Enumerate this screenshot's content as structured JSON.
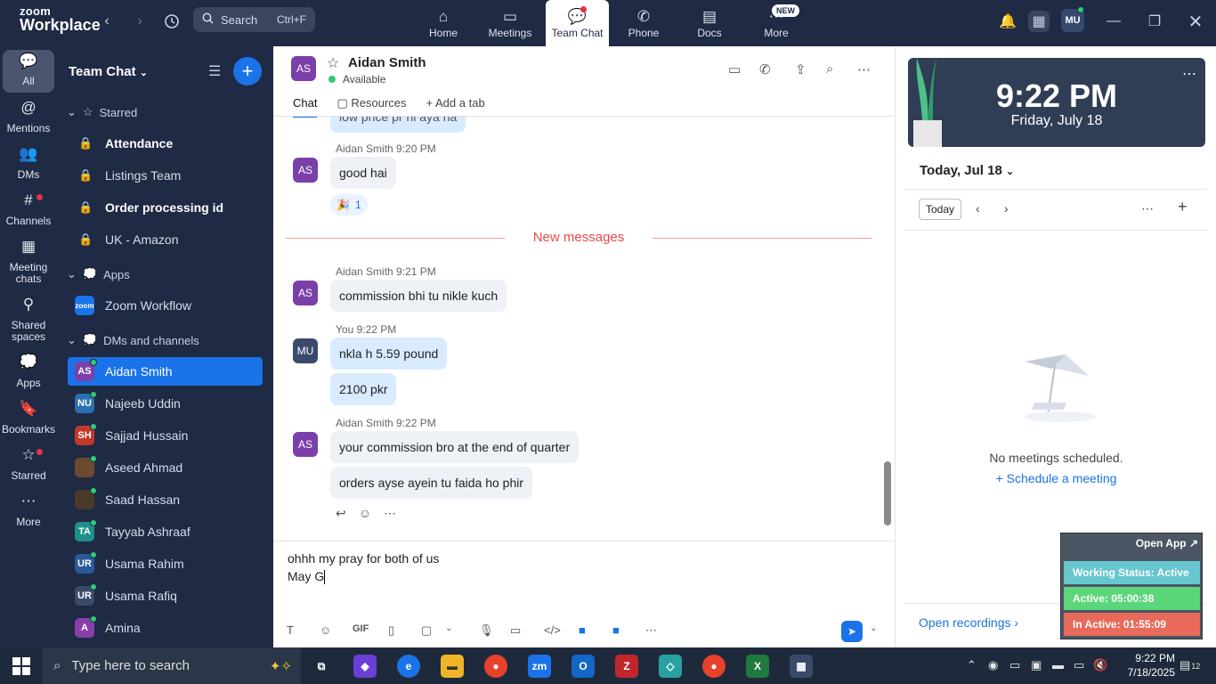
{
  "topbar": {
    "logo_line1": "zoom",
    "logo_line2": "Workplace",
    "search_label": "Search",
    "search_shortcut": "Ctrl+F",
    "tabs": [
      {
        "label": "Home",
        "icon": "home-icon"
      },
      {
        "label": "Meetings",
        "icon": "video-icon"
      },
      {
        "label": "Team Chat",
        "icon": "chat-icon"
      },
      {
        "label": "Phone",
        "icon": "phone-icon"
      },
      {
        "label": "Docs",
        "icon": "doc-icon"
      },
      {
        "label": "More",
        "icon": "more-icon",
        "badge": "NEW"
      }
    ],
    "avatar": "MU"
  },
  "rail": [
    {
      "label": "All"
    },
    {
      "label": "Mentions"
    },
    {
      "label": "DMs"
    },
    {
      "label": "Channels"
    },
    {
      "label": "Meeting chats"
    },
    {
      "label": "Shared spaces"
    },
    {
      "label": "Apps"
    },
    {
      "label": "Bookmarks"
    },
    {
      "label": "Starred"
    },
    {
      "label": "More"
    }
  ],
  "sidebar": {
    "title": "Team Chat",
    "sections": {
      "starred": "Starred",
      "apps": "Apps",
      "dms": "DMs and channels"
    },
    "starred_items": [
      {
        "label": "Attendance"
      },
      {
        "label": "Listings Team"
      },
      {
        "label": "Order processing id"
      },
      {
        "label": "UK - Amazon"
      }
    ],
    "app_items": [
      {
        "label": "Zoom Workflow",
        "avatar": "zoom"
      }
    ],
    "dm_items": [
      {
        "label": "Aidan Smith",
        "initials": "AS",
        "color": "#7a3fa8"
      },
      {
        "label": "Najeeb Uddin",
        "initials": "NU",
        "color": "#2a6fb0"
      },
      {
        "label": "Sajjad Hussain",
        "initials": "SH",
        "color": "#c0392b"
      },
      {
        "label": "Aseed Ahmad",
        "initials": "",
        "color": "#6b4a2f"
      },
      {
        "label": "Saad Hassan",
        "initials": "",
        "color": "#4a3a2a"
      },
      {
        "label": "Tayyab Ashraaf",
        "initials": "TA",
        "color": "#1e8f8a"
      },
      {
        "label": "Usama Rahim",
        "initials": "UR",
        "color": "#2a5a9a"
      },
      {
        "label": "Usama Rafiq",
        "initials": "UR",
        "color": "#3a4a6a"
      },
      {
        "label": "Amina",
        "initials": "A",
        "color": "#8a3fa8"
      }
    ]
  },
  "chat": {
    "contact_initials": "AS",
    "contact_name": "Aidan Smith",
    "contact_status": "Available",
    "tabs": [
      "Chat",
      "Resources",
      "Add a tab"
    ],
    "messages": [
      {
        "meta": "Aidan Smith 9:20 PM",
        "bubbles": [
          "good hai"
        ],
        "reaction": "1"
      },
      {
        "meta": "Aidan Smith 9:21 PM",
        "bubbles": [
          "commission bhi tu nikle kuch"
        ]
      },
      {
        "meta": "You 9:22 PM",
        "bubbles": [
          "nkla h 5.59 pound",
          "2100 pkr"
        ],
        "avatar": "MU"
      },
      {
        "meta": "Aidan Smith 9:22 PM",
        "bubbles": [
          "your commission bro at the end of quarter",
          "orders ayse ayein tu faida ho phir"
        ]
      }
    ],
    "partial_top": "low price pr hi aya ha",
    "new_messages_label": "New messages",
    "compose_line1": "ohhh my pray for both of us",
    "compose_line2": "May G"
  },
  "right": {
    "time": "9:22 PM",
    "date": "Friday, July 18",
    "day_header": "Today, Jul 18",
    "today_button": "Today",
    "empty_text": "No meetings scheduled.",
    "schedule_link": "Schedule a meeting",
    "open_recordings": "Open recordings"
  },
  "widget": {
    "open_app": "Open App",
    "working_status": "Working Status: Active",
    "active": "Active: 05:00:38",
    "inactive": "In Active: 01:55:09",
    "colors": {
      "status": "#66c7cf",
      "active": "#5cd67a",
      "inactive": "#e86a5a"
    }
  },
  "taskbar": {
    "search_placeholder": "Type here to search",
    "time": "9:22 PM",
    "date": "7/18/2025",
    "notifications": "12"
  }
}
